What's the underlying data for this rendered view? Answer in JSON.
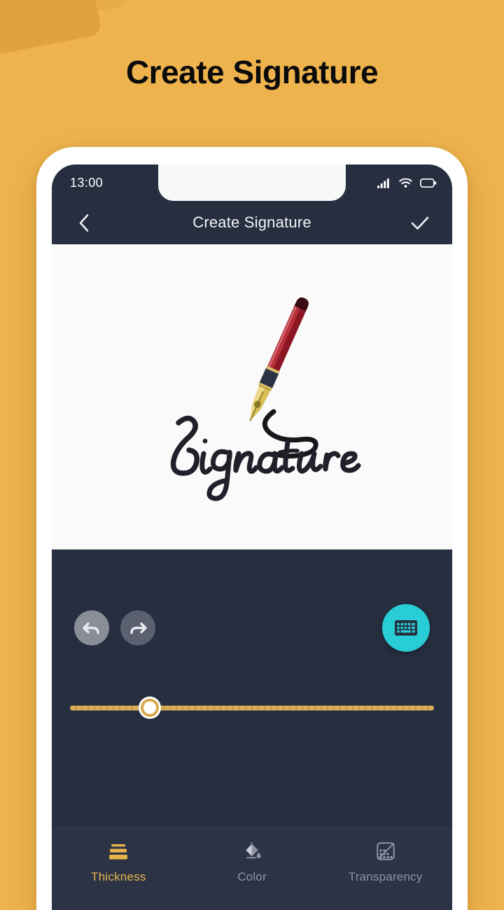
{
  "promo": {
    "headline": "Create Signature",
    "background_color": "#EEB34D"
  },
  "phone": {
    "status_bar": {
      "time": "13:00",
      "icons": [
        "signal-icon",
        "wifi-icon",
        "battery-icon"
      ],
      "background_color": "#262E40"
    },
    "app_bar": {
      "back_icon": "chevron-left-icon",
      "title": "Create Signature",
      "confirm_icon": "check-icon",
      "background_color": "#262E40"
    },
    "canvas": {
      "artwork": "signature-illustration",
      "artwork_caption": "Signature",
      "background_color": "#FAFAFA",
      "pen_body_color": "#9E1B28",
      "pen_nib_color": "#E9D47A",
      "ink_color": "#17171C"
    },
    "tools": {
      "undo_icon": "undo-arrow-icon",
      "undo_label": "Undo",
      "redo_icon": "redo-arrow-icon",
      "redo_label": "Redo",
      "keyboard_icon": "keyboard-icon",
      "keyboard_label": "Keyboard",
      "keyboard_button_color": "#29CDD6",
      "panel_background_color": "#262E40"
    },
    "slider": {
      "name": "thickness-slider",
      "value_percent": 22,
      "track_color": "#D9AE5A",
      "thumb_color": "#FFFFFF"
    },
    "tab_bar": {
      "active_color": "#E8B54A",
      "inactive_color": "#8E94A3",
      "background_color": "#2B3345",
      "tabs": [
        {
          "label": "Thickness",
          "icon": "thickness-lines-icon",
          "active": true
        },
        {
          "label": "Color",
          "icon": "paint-bucket-icon",
          "active": false
        },
        {
          "label": "Transparency",
          "icon": "transparency-grid-icon",
          "active": false
        }
      ]
    }
  }
}
